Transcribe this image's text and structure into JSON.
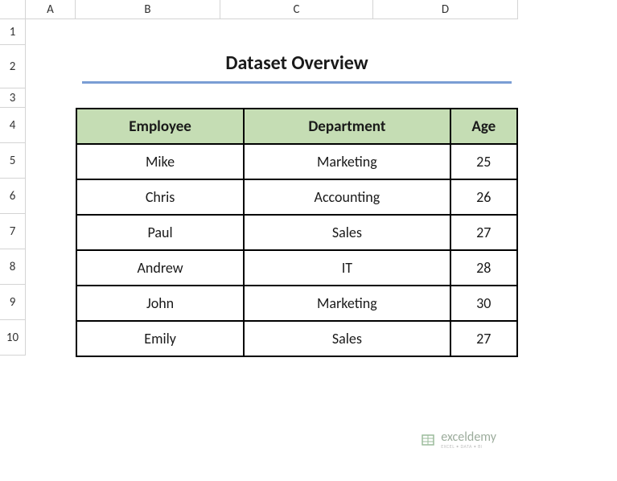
{
  "columns": [
    "A",
    "B",
    "C",
    "D"
  ],
  "rows": [
    "1",
    "2",
    "3",
    "4",
    "5",
    "6",
    "7",
    "8",
    "9",
    "10"
  ],
  "title": "Dataset Overview",
  "table": {
    "headers": [
      "Employee",
      "Department",
      "Age"
    ],
    "data": [
      [
        "Mike",
        "Marketing",
        "25"
      ],
      [
        "Chris",
        "Accounting",
        "26"
      ],
      [
        "Paul",
        "Sales",
        "27"
      ],
      [
        "Andrew",
        "IT",
        "28"
      ],
      [
        "John",
        "Marketing",
        "30"
      ],
      [
        "Emily",
        "Sales",
        "27"
      ]
    ]
  },
  "watermark": {
    "main": "exceldemy",
    "sub": "EXCEL • DATA • BI"
  }
}
